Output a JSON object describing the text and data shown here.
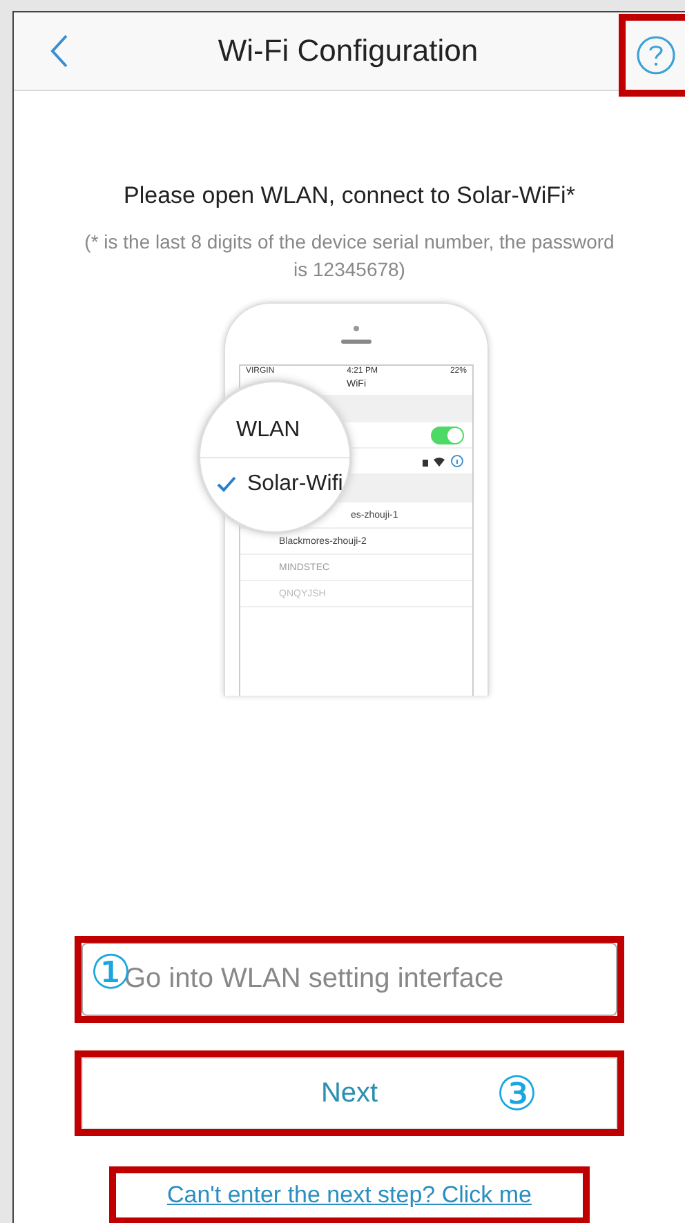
{
  "header": {
    "title": "Wi-Fi Configuration",
    "help_highlighted": true
  },
  "instruction": {
    "title": "Please open WLAN, connect to Solar-WiFi*",
    "note": "(* is the last 8 digits of the device serial number, the password is 12345678)"
  },
  "illustration": {
    "carrier": "VIRGIN",
    "time": "4:21 PM",
    "battery": "22%",
    "screen_title": "WiFi",
    "wifi_on": true,
    "networks": [
      {
        "name": "es-zhouji-1"
      },
      {
        "name": "Blackmores-zhouji-2"
      },
      {
        "name": "MINDSTEC"
      },
      {
        "name": "QNQYJSH"
      }
    ],
    "magnifier": {
      "section": "WLAN",
      "network": "Solar-Wifi",
      "checked": true
    }
  },
  "input": {
    "placeholder": "Go into WLAN setting interface",
    "highlighted": true,
    "annotation": "①"
  },
  "next_button": {
    "label": "Next",
    "highlighted": true,
    "annotation": "③"
  },
  "help_link": {
    "label": "Can't enter the next step? Click me",
    "highlighted": true
  }
}
